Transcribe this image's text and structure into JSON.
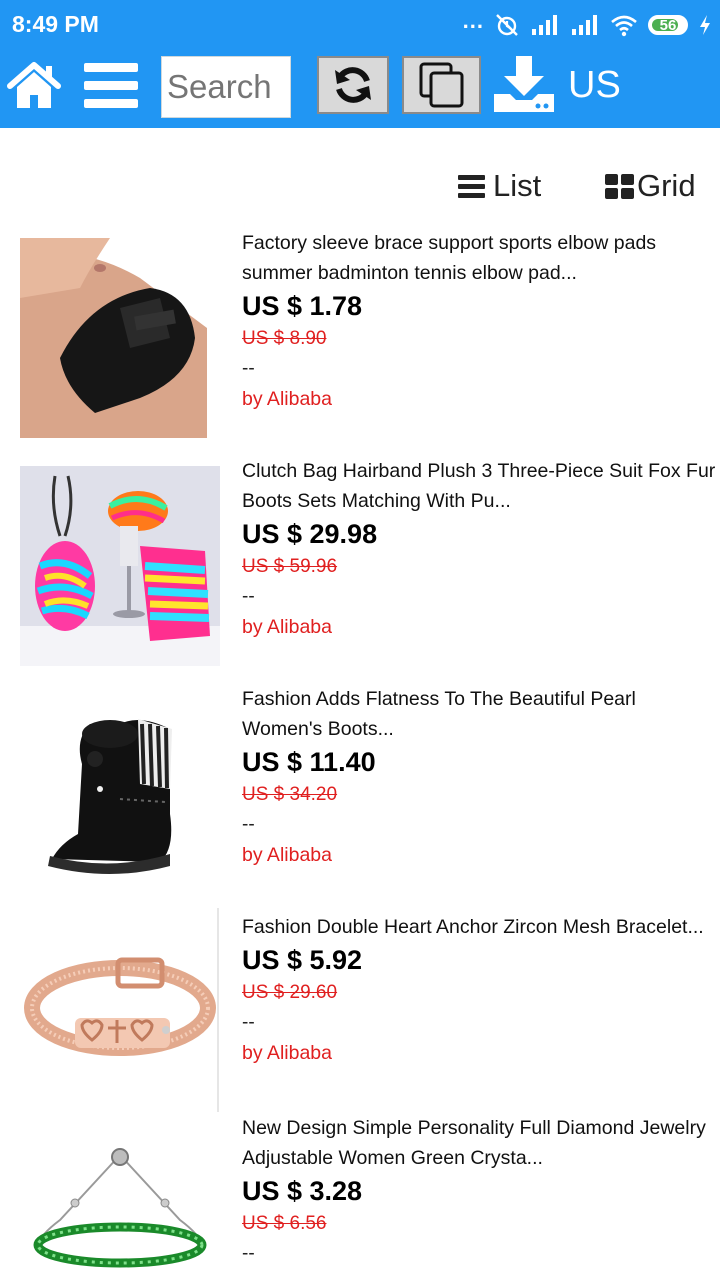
{
  "status_bar": {
    "time": "8:49 PM",
    "dots": "...",
    "battery": "56",
    "charging_icon": "bolt-icon"
  },
  "toolbar": {
    "search_placeholder": "Search",
    "currency": "US"
  },
  "view_toggle": {
    "list_label": "List",
    "grid_label": "Grid"
  },
  "products": [
    {
      "title": "Factory sleeve brace support sports elbow pads summer badminton tennis elbow pad...",
      "price": "US $ 1.78",
      "original_price": "US $ 8.90",
      "rating": "--",
      "seller": "by Alibaba"
    },
    {
      "title": "Clutch Bag Hairband Plush 3 Three-Piece Suit Fox Fur Boots Sets Matching With Pu...",
      "price": "US $ 29.98",
      "original_price": "US $ 59.96",
      "rating": "--",
      "seller": "by Alibaba"
    },
    {
      "title": "Fashion Adds Flatness To The Beautiful Pearl Women's Boots...",
      "price": "US $ 11.40",
      "original_price": "US $ 34.20",
      "rating": "--",
      "seller": "by Alibaba"
    },
    {
      "title": "Fashion Double Heart Anchor Zircon Mesh Bracelet...",
      "price": "US $ 5.92",
      "original_price": "US $ 29.60",
      "rating": "--",
      "seller": "by Alibaba"
    },
    {
      "title": "New Design Simple Personality Full Diamond Jewelry Adjustable Women Green Crysta...",
      "price": "US $ 3.28",
      "original_price": "US $ 6.56",
      "rating": "--",
      "seller": ""
    }
  ],
  "colors": {
    "primary": "#2196F3",
    "sale_red": "#e02020"
  }
}
